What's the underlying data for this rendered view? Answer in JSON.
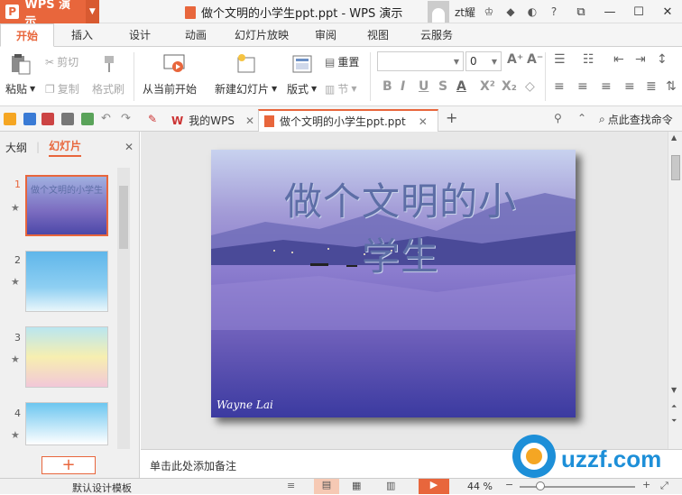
{
  "app": {
    "name": "WPS 演示",
    "doc_title": "做个文明的小学生ppt.ppt - WPS 演示",
    "user": "zt耀"
  },
  "tabs": [
    "开始",
    "插入",
    "设计",
    "动画",
    "幻灯片放映",
    "审阅",
    "视图",
    "云服务"
  ],
  "ribbon": {
    "paste": "粘贴",
    "cut": "剪切",
    "copy": "复制",
    "format_painter": "格式刷",
    "from_current": "从当前开始",
    "new_slide": "新建幻灯片",
    "layout": "版式",
    "reset": "重置",
    "section": "节",
    "font_size": "0"
  },
  "doc_tabs": {
    "my_wps": "我的WPS",
    "current": "做个文明的小学生ppt.ppt"
  },
  "search": {
    "label": "点此查找命令"
  },
  "left_panel": {
    "outline_tab": "大纲",
    "slides_tab": "幻灯片",
    "slide_numbers": [
      "1",
      "2",
      "3",
      "4"
    ]
  },
  "slide": {
    "title": "做个文明的小学生",
    "signature": "Wayne Lai"
  },
  "notes": {
    "placeholder": "单击此处添加备注"
  },
  "status": {
    "template": "默认设计模板",
    "zoom": "44 %"
  },
  "watermark": "uzzf.com"
}
